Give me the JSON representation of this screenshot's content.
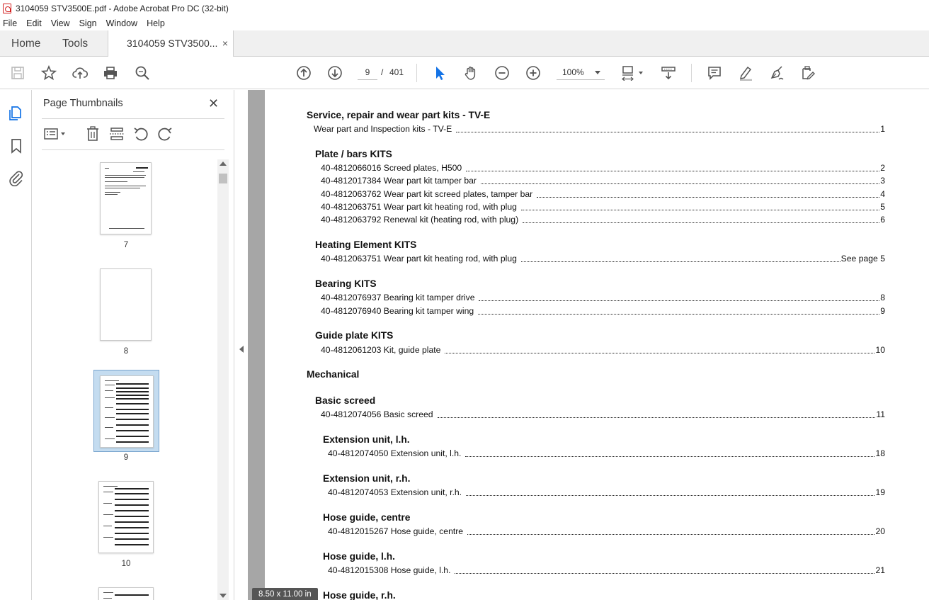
{
  "window": {
    "title": "3104059 STV3500E.pdf - Adobe Acrobat Pro DC (32-bit)"
  },
  "menu": [
    "File",
    "Edit",
    "View",
    "Sign",
    "Window",
    "Help"
  ],
  "tabs": {
    "home": "Home",
    "tools": "Tools",
    "document": "3104059 STV3500...",
    "close": "×"
  },
  "toolbar": {
    "current_page": "9",
    "page_separator": "/",
    "total_pages": "401",
    "zoom": "100%"
  },
  "thumbnails": {
    "title": "Page Thumbnails",
    "close": "✕",
    "pages": [
      "7",
      "8",
      "9",
      "10"
    ],
    "selected_page": "9"
  },
  "toc": {
    "sections": [
      {
        "title": "Service, repair and wear part kits - TV-E"
      },
      {
        "entry": "Wear part and Inspection kits - TV-E",
        "page": "1"
      },
      {
        "title": "Plate / bars KITS"
      },
      {
        "entry": "40-4812066016 Screed plates, H500",
        "page": "2"
      },
      {
        "entry": "40-4812017384 Wear part kit tamper bar",
        "page": "3"
      },
      {
        "entry": "40-4812063762 Wear part kit screed plates, tamper bar",
        "page": "4"
      },
      {
        "entry": "40-4812063751 Wear part kit heating rod, with plug",
        "page": "5"
      },
      {
        "entry": "40-4812063792 Renewal kit (heating rod, with plug)",
        "page": "6"
      },
      {
        "title": "Heating Element KITS"
      },
      {
        "entry": "40-4812063751 Wear part kit heating rod, with plug",
        "page": "See page 5"
      },
      {
        "title": "Bearing KITS"
      },
      {
        "entry": "40-4812076937 Bearing kit tamper drive",
        "page": "8"
      },
      {
        "entry": "40-4812076940 Bearing kit tamper wing",
        "page": "9"
      },
      {
        "title": "Guide plate KITS"
      },
      {
        "entry": "40-4812061203 Kit, guide plate",
        "page": "10"
      },
      {
        "title": "Mechanical"
      },
      {
        "title": "Basic screed"
      },
      {
        "entry": "40-4812074056 Basic screed",
        "page": "11"
      },
      {
        "title": "Extension unit, l.h."
      },
      {
        "entry": "40-4812074050 Extension unit, l.h.",
        "page": "18"
      },
      {
        "title": "Extension unit, r.h."
      },
      {
        "entry": "40-4812074053 Extension unit, r.h.",
        "page": "19"
      },
      {
        "title": "Hose guide, centre"
      },
      {
        "entry": "40-4812015267 Hose guide, centre",
        "page": "20"
      },
      {
        "title": "Hose guide, l.h."
      },
      {
        "entry": "40-4812015308 Hose guide, l.h.",
        "page": "21"
      },
      {
        "title": "Hose guide, r.h."
      }
    ]
  },
  "status": {
    "page_size": "8.50 x 11.00 in"
  },
  "colors": {
    "accent_blue": "#1473e6",
    "select_blue": "#c4dcf0",
    "doc_bg": "#a6a6a6"
  }
}
